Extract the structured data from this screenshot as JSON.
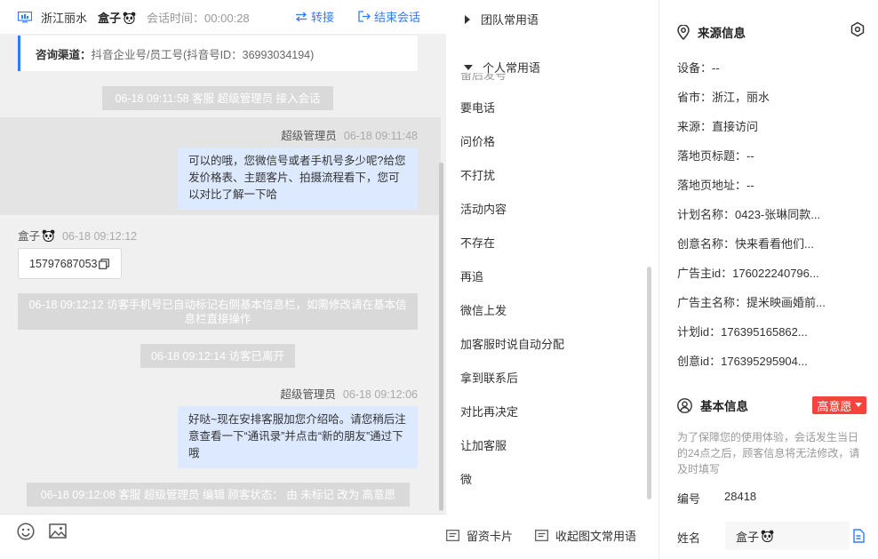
{
  "header": {
    "region": "浙江丽水",
    "visitor_name": "盒子",
    "timer_label": "会话时间：",
    "timer_value": "00:00:28",
    "transfer_label": "转接",
    "end_label": "结束会话"
  },
  "chat": {
    "info_card": {
      "key": "咨询渠道：",
      "value": "抖音企业号/员工号(抖音号ID：36993034194)"
    },
    "system_messages": [
      "06-18 09:11:58 客服 超级管理员 接入会话",
      "06-18 09:12:12 访客手机号已自动标记右侧基本信息栏，如需修改请在基本信息栏直接操作",
      "06-18 09:12:14 访客已离开",
      "06-18 09:12:08 客服 超级管理员 编辑 顾客状态： 由 未标记 改为 高意愿"
    ],
    "messages": [
      {
        "sender": "超级管理员",
        "time": "06-18 09:11:48",
        "text": "可以的哦，您微信号或者手机号多少呢?给您发价格表、主题客片、拍摄流程看下，您可以对比了解一下哈"
      },
      {
        "sender": "盒子",
        "time": "06-18 09:12:12",
        "text": "15797687053"
      },
      {
        "sender": "超级管理员",
        "time": "06-18 09:12:06",
        "text": "好哒~现在安排客服加您介绍哈。请您稍后注意查看一下“通讯录”并点击“新的朋友”通过下哦"
      }
    ]
  },
  "phrases": {
    "team_group": "团队常用语",
    "personal_group": "个人常用语",
    "clipped_item": "留后发号",
    "items": [
      "要电话",
      "问价格",
      "不打扰",
      "活动内容",
      "不存在",
      "再追",
      "微信上发",
      "加客服时说自动分配",
      "拿到联系后",
      "对比再决定",
      "让加客服",
      "微"
    ],
    "footer_card": "留资卡片",
    "footer_collapse": "收起图文常用语"
  },
  "info": {
    "source_title": "来源信息",
    "source_fields": [
      "设备：--",
      "省市：浙江，丽水",
      "来源：直接访问",
      "落地页标题：--",
      "落地页地址：--",
      "计划名称：0423-张琳同款...",
      "创意名称：快来看看他们...",
      "广告主id：176022240796...",
      "广告主名称：提米映画婚前...",
      "计划id：176395165862...",
      "创意id：176395295904..."
    ],
    "basic_title": "基本信息",
    "intent_tag": "高意愿",
    "notice": "为了保障您的使用体验，会话发生当日的24点之后，顾客信息将无法修改，请及时填写",
    "id_label": "编号",
    "id_value": "28418",
    "name_label": "姓名",
    "name_value": "盒子"
  },
  "colors": {
    "accent": "#2f7bff",
    "agent_bubble": "#dce9ff",
    "system_bg": "#d9d9d9",
    "intent_tag": "#f5443c"
  }
}
